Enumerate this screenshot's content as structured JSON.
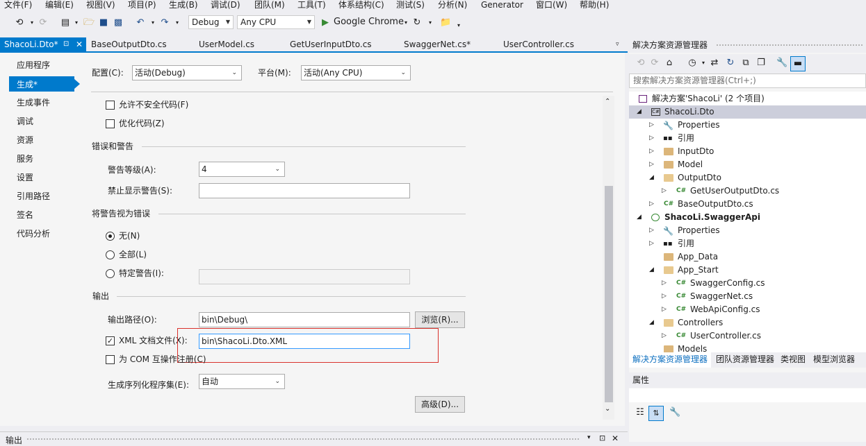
{
  "menu": [
    "文件(F)",
    "编辑(E)",
    "视图(V)",
    "项目(P)",
    "生成(B)",
    "调试(D)",
    "团队(M)",
    "工具(T)",
    "体系结构(C)",
    "测试(S)",
    "分析(N)",
    "Generator",
    "窗口(W)",
    "帮助(H)"
  ],
  "toolbar": {
    "config": "Debug",
    "platform": "Any CPU",
    "run_target": "Google Chrome"
  },
  "doc_tabs": [
    {
      "label": "ShacoLi.Dto*"
    },
    {
      "label": "BaseOutputDto.cs"
    },
    {
      "label": "UserModel.cs"
    },
    {
      "label": "GetUserInputDto.cs"
    },
    {
      "label": "SwaggerNet.cs*"
    },
    {
      "label": "UserController.cs"
    }
  ],
  "nav": {
    "items": [
      "应用程序",
      "生成*",
      "生成事件",
      "调试",
      "资源",
      "服务",
      "设置",
      "引用路径",
      "签名",
      "代码分析"
    ],
    "active_index": 1
  },
  "header": {
    "config_label": "配置(C):",
    "config_value": "活动(Debug)",
    "platform_label": "平台(M):",
    "platform_value": "活动(Any CPU)"
  },
  "general": {
    "unsafe_label": "允许不安全代码(F)",
    "optimize_label": "优化代码(Z)"
  },
  "errors": {
    "section": "错误和警告",
    "warning_level_label": "警告等级(A):",
    "warning_level_value": "4",
    "suppress_label": "禁止显示警告(S):",
    "suppress_value": ""
  },
  "treat_warnings": {
    "section": "将警告视为错误",
    "none_label": "无(N)",
    "all_label": "全部(L)",
    "specific_label": "特定警告(I):",
    "specific_value": ""
  },
  "output": {
    "section": "输出",
    "path_label": "输出路径(O):",
    "path_value": "bin\\Debug\\",
    "browse_label": "浏览(R)...",
    "xml_label": "XML 文档文件(X):",
    "xml_checked": true,
    "xml_value": "bin\\ShacoLi.Dto.XML",
    "com_label": "为 COM 互操作注册(C)",
    "serial_label": "生成序列化程序集(E):",
    "serial_value": "自动",
    "advanced_label": "高级(D)..."
  },
  "solution": {
    "title": "解决方案资源管理器",
    "search_placeholder": "搜索解决方案资源管理器(Ctrl+;)",
    "nodes": [
      {
        "text": "解决方案'ShacoLi' (2 个项目)",
        "icon": "solution-icon"
      },
      {
        "text": "ShacoLi.Dto",
        "icon": "csproj-icon"
      },
      {
        "text": "Properties",
        "icon": "wrench-icon"
      },
      {
        "text": "引用",
        "icon": "references-icon"
      },
      {
        "text": "InputDto",
        "icon": "folder-icon"
      },
      {
        "text": "Model",
        "icon": "folder-icon"
      },
      {
        "text": "OutputDto",
        "icon": "folder-open-icon"
      },
      {
        "text": "GetUserOutputDto.cs",
        "icon": "csharp-file-icon"
      },
      {
        "text": "BaseOutputDto.cs",
        "icon": "csharp-file-icon"
      },
      {
        "text": "ShacoLi.SwaggerApi",
        "icon": "webproj-icon"
      },
      {
        "text": "Properties",
        "icon": "wrench-icon"
      },
      {
        "text": "引用",
        "icon": "references-icon"
      },
      {
        "text": "App_Data",
        "icon": "folder-icon"
      },
      {
        "text": "App_Start",
        "icon": "folder-open-icon"
      },
      {
        "text": "SwaggerConfig.cs",
        "icon": "csharp-file-icon"
      },
      {
        "text": "SwaggerNet.cs",
        "icon": "csharp-file-icon"
      },
      {
        "text": "WebApiConfig.cs",
        "icon": "csharp-file-icon"
      },
      {
        "text": "Controllers",
        "icon": "folder-open-icon"
      },
      {
        "text": "UserController.cs",
        "icon": "csharp-file-icon"
      },
      {
        "text": "Models",
        "icon": "folder-icon"
      }
    ],
    "tabs": [
      "解决方案资源管理器",
      "团队资源管理器",
      "类视图",
      "模型浏览器"
    ]
  },
  "properties": {
    "title": "属性"
  },
  "output_panel": {
    "title": "输出"
  },
  "colors": {
    "accent": "#007acc",
    "highlight_box": "#d9312b"
  }
}
